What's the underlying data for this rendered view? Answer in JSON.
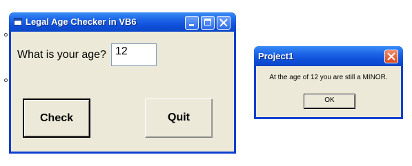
{
  "main_window": {
    "title": "Legal Age Checker in VB6",
    "age_label": "What is your age?",
    "age_value": "12",
    "check_button": "Check",
    "quit_button": "Quit"
  },
  "message_box": {
    "title": "Project1",
    "message": "At the age of 12 you are still a MINOR.",
    "ok_button": "OK"
  },
  "icons": {
    "app": "form-icon",
    "minimize": "minimize-icon",
    "maximize": "maximize-icon",
    "close": "close-icon"
  },
  "colors": {
    "titlebar": "#1b63e6",
    "window_face": "#ece9d8",
    "close_button": "#d9481e"
  }
}
